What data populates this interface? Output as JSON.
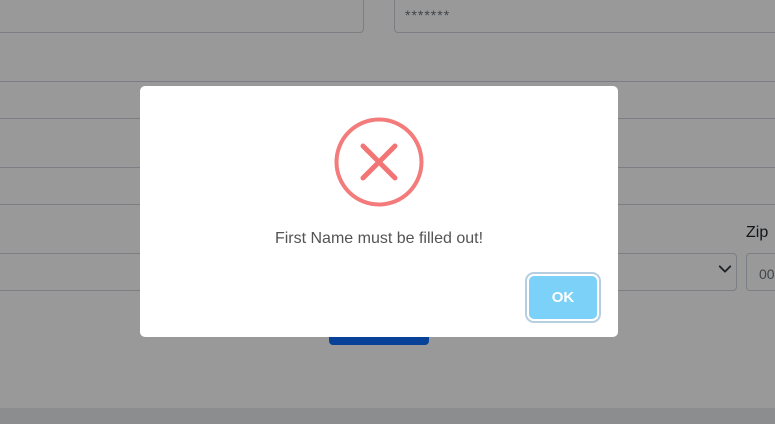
{
  "form": {
    "password_value": "*******",
    "zip_label": "Zip",
    "zip_value": "00"
  },
  "modal": {
    "icon": "error-x-icon",
    "message": "First Name must be filled out!",
    "ok_label": "OK"
  },
  "colors": {
    "error_red": "#f27474",
    "ok_button": "#7cd1f9",
    "submit_button": "#0d6efd",
    "overlay": "rgba(0,0,0,0.4)"
  }
}
